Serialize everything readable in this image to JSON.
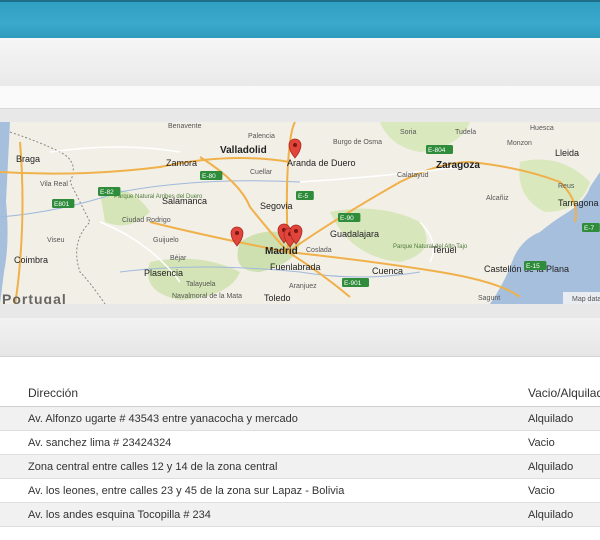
{
  "colors": {
    "topbar": "#3aa9cc",
    "marker": "#e0443a",
    "water": "#a5bfdd"
  },
  "map": {
    "cities": [
      {
        "name": "Benavente",
        "kind": "small"
      },
      {
        "name": "Palencia",
        "kind": "small"
      },
      {
        "name": "Burgo de Osma",
        "kind": "small"
      },
      {
        "name": "Soria",
        "kind": "small"
      },
      {
        "name": "Tudela",
        "kind": "small"
      },
      {
        "name": "Huesca",
        "kind": "small"
      },
      {
        "name": "Braga",
        "kind": "city"
      },
      {
        "name": "Zamora",
        "kind": "city"
      },
      {
        "name": "Valladolid",
        "kind": "big"
      },
      {
        "name": "Aranda de Duero",
        "kind": "city"
      },
      {
        "name": "Zaragoza",
        "kind": "big"
      },
      {
        "name": "Monzon",
        "kind": "small"
      },
      {
        "name": "Lleida",
        "kind": "city"
      },
      {
        "name": "Vila Real",
        "kind": "small"
      },
      {
        "name": "Cuellar",
        "kind": "small"
      },
      {
        "name": "Calatayud",
        "kind": "small"
      },
      {
        "name": "Reus",
        "kind": "small"
      },
      {
        "name": "Salamanca",
        "kind": "city"
      },
      {
        "name": "Segovia",
        "kind": "city"
      },
      {
        "name": "Alcañiz",
        "kind": "small"
      },
      {
        "name": "Tarragona",
        "kind": "city"
      },
      {
        "name": "Viseu",
        "kind": "small"
      },
      {
        "name": "Ciudad Rodrigo",
        "kind": "small"
      },
      {
        "name": "Guadalajara",
        "kind": "city"
      },
      {
        "name": "Madrid",
        "kind": "big"
      },
      {
        "name": "Coslada",
        "kind": "small"
      },
      {
        "name": "Teruel",
        "kind": "city"
      },
      {
        "name": "Coimbra",
        "kind": "city"
      },
      {
        "name": "Guijuelo",
        "kind": "small"
      },
      {
        "name": "Béjar",
        "kind": "small"
      },
      {
        "name": "Fuenlabrada",
        "kind": "city"
      },
      {
        "name": "Cuenca",
        "kind": "city"
      },
      {
        "name": "Castellón de la Plana",
        "kind": "city"
      },
      {
        "name": "Plasencia",
        "kind": "city"
      },
      {
        "name": "Talayuela",
        "kind": "small"
      },
      {
        "name": "Aranjuez",
        "kind": "small"
      },
      {
        "name": "Navalmoral de la Mata",
        "kind": "small"
      },
      {
        "name": "Toledo",
        "kind": "city"
      },
      {
        "name": "Sagunt",
        "kind": "small"
      },
      {
        "name": "Parque Natural Arribes del Duero",
        "kind": "park"
      },
      {
        "name": "Parque Natural del Alto Tajo",
        "kind": "park"
      },
      {
        "name": "Portugal",
        "kind": "country"
      }
    ],
    "roads": [
      "E-80",
      "E-82",
      "E-5",
      "E-90",
      "E-804",
      "E-7",
      "E-901",
      "E-15",
      "E801"
    ],
    "attribution": "Map data"
  },
  "table": {
    "headers": {
      "address": "Dirección",
      "status": "Vacio/Alquilado"
    },
    "rows": [
      {
        "address": "Av. Alfonzo ugarte # 43543 entre yanacocha y mercado",
        "status": "Alquilado"
      },
      {
        "address": "Av. sanchez lima # 23424324",
        "status": "Vacio"
      },
      {
        "address": "Zona central entre calles 12 y 14 de la zona central",
        "status": "Alquilado"
      },
      {
        "address": "Av. los leones, entre calles 23 y 45 de la zona sur Lapaz - Bolivia",
        "status": "Vacio"
      },
      {
        "address": "Av. los andes esquina Tocopilla # 234",
        "status": "Alquilado"
      }
    ]
  }
}
